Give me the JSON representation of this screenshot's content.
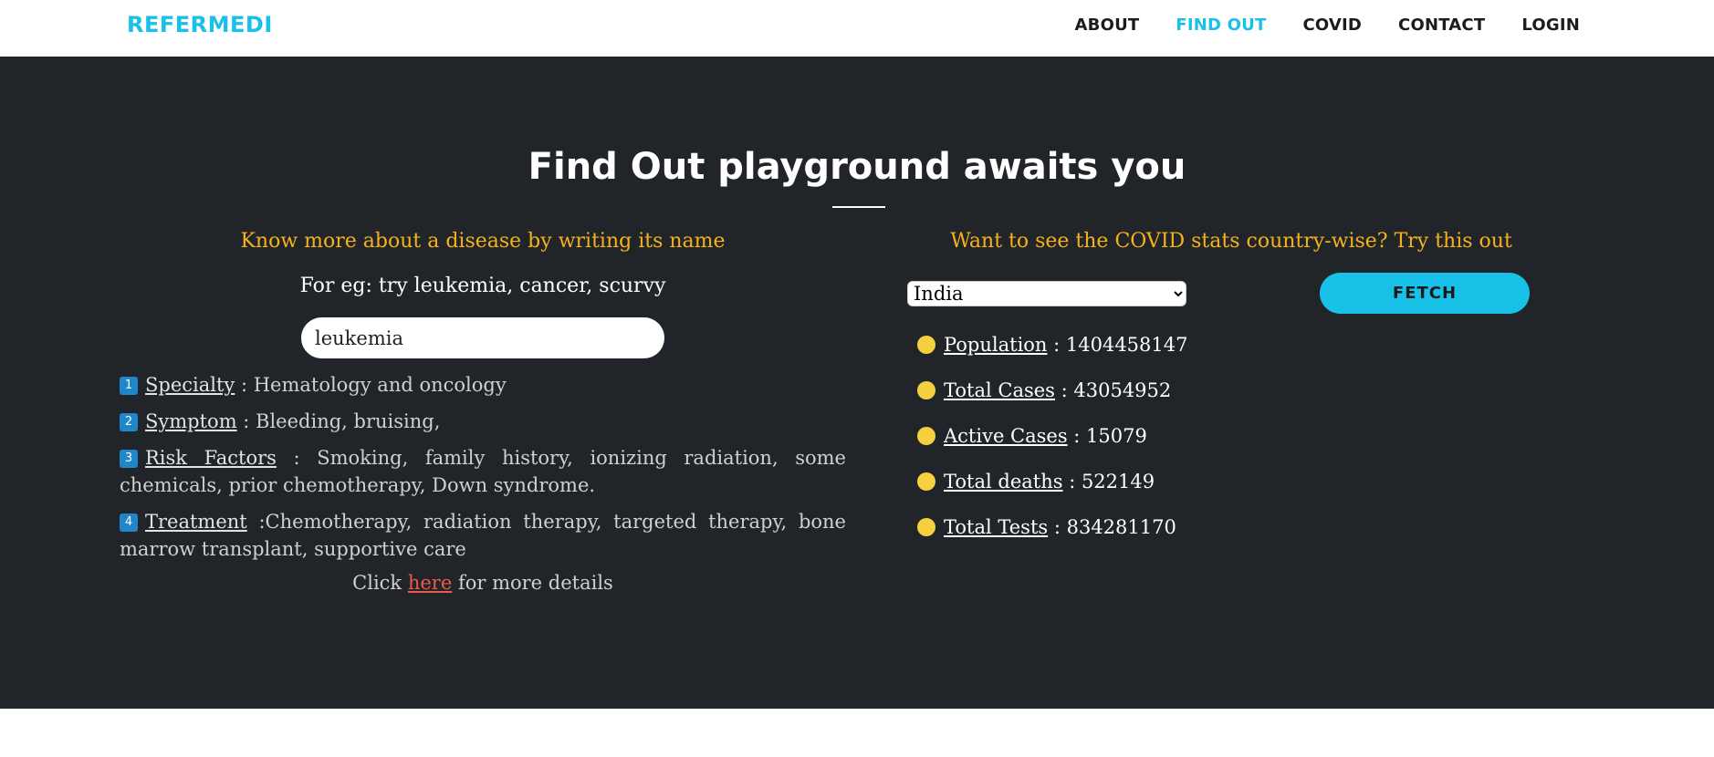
{
  "nav": {
    "brand": "REFERMEDI",
    "links": [
      "ABOUT",
      "FIND OUT",
      "COVID",
      "CONTACT",
      "LOGIN"
    ],
    "active": "FIND OUT"
  },
  "hero": {
    "title": "Find Out playground awaits you"
  },
  "disease": {
    "heading": "Know more about a disease by writing its name",
    "example": "For eg: try leukemia, cancer, scurvy",
    "input_value": "leukemia",
    "facts": [
      {
        "icon": "1",
        "label": "Specialty",
        "value": " : Hematology and oncology"
      },
      {
        "icon": "2",
        "label": "Symptom",
        "value": " : Bleeding, bruising,"
      },
      {
        "icon": "3",
        "label": "Risk Factors",
        "value": " : Smoking, family history, ionizing radiation, some chemicals, prior chemotherapy, Down syndrome."
      },
      {
        "icon": "4",
        "label": "Treatment",
        "value": " :Chemotherapy, radiation therapy, targeted therapy, bone marrow transplant, supportive care"
      }
    ],
    "more_prefix": "Click ",
    "more_link": "here",
    "more_suffix": " for more details"
  },
  "covid": {
    "heading": "Want to see the COVID stats country-wise? Try this out",
    "selected_country": "India",
    "fetch_label": "FETCH",
    "stats": [
      {
        "label": "Population",
        "value": " : 1404458147"
      },
      {
        "label": "Total Cases",
        "value": " : 43054952"
      },
      {
        "label": "Active Cases",
        "value": " : 15079"
      },
      {
        "label": "Total deaths",
        "value": " : 522149"
      },
      {
        "label": "Total Tests",
        "value": " : 834281170"
      }
    ]
  },
  "colors": {
    "accent": "#17c1e8",
    "hero_bg": "#212529",
    "gold": "#f6b21b",
    "stat_dot": "#f5d142",
    "link_red": "#ec5a4a",
    "icon_blue": "#1f86c9"
  }
}
